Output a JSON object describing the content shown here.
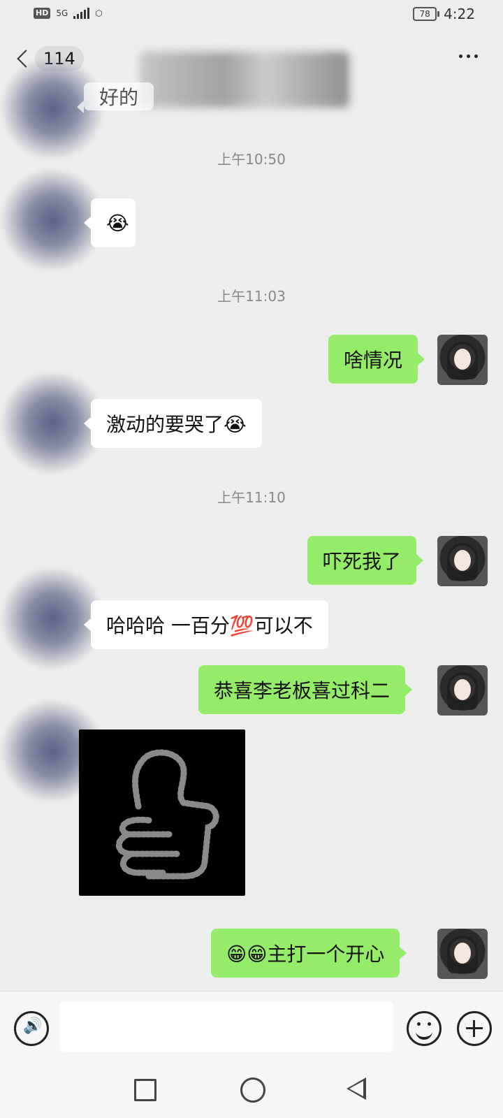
{
  "status_bar": {
    "network_badge": "HD",
    "network_type": "5G",
    "battery": "78",
    "time": "4:22"
  },
  "header": {
    "unread_count": "114"
  },
  "messages": [
    {
      "type": "timestamp",
      "text": "上午10:50"
    },
    {
      "type": "timestamp",
      "text": "上午11:03"
    },
    {
      "type": "out",
      "text": "啥情况"
    },
    {
      "type": "in",
      "text": "激动的要哭了😭"
    },
    {
      "type": "timestamp",
      "text": "上午11:10"
    },
    {
      "type": "out",
      "text": "吓死我了"
    },
    {
      "type": "in",
      "text": "哈哈哈  一百分💯可以不"
    },
    {
      "type": "out",
      "text": "恭喜李老板喜过科二"
    },
    {
      "type": "in",
      "sticker": "thumbs-up"
    },
    {
      "type": "out",
      "text": "😁😁主打一个开心"
    }
  ],
  "top_partial_text": "好的",
  "colors": {
    "background": "#ededed",
    "outgoing_bubble": "#95ec69",
    "incoming_bubble": "#ffffff"
  }
}
